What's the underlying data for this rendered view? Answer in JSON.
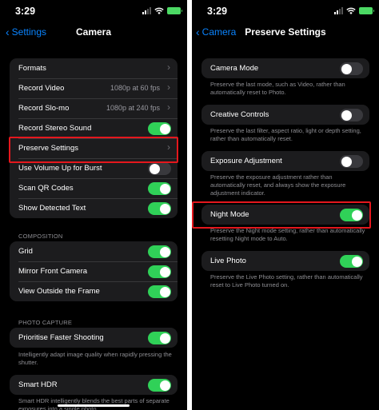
{
  "left": {
    "status": {
      "time": "3:29"
    },
    "nav": {
      "back_label": "Settings",
      "title": "Camera"
    },
    "group1": {
      "formats": "Formats",
      "record_video": {
        "label": "Record Video",
        "value": "1080p at 60 fps"
      },
      "record_slomo": {
        "label": "Record Slo-mo",
        "value": "1080p at 240 fps"
      },
      "stereo": {
        "label": "Record Stereo Sound",
        "on": true
      },
      "preserve": "Preserve Settings",
      "volume": {
        "label": "Use Volume Up for Burst",
        "on": false
      },
      "qr": {
        "label": "Scan QR Codes",
        "on": true
      },
      "detected_text": {
        "label": "Show Detected Text",
        "on": true
      }
    },
    "composition": {
      "header": "COMPOSITION",
      "grid": {
        "label": "Grid",
        "on": true
      },
      "mirror": {
        "label": "Mirror Front Camera",
        "on": true
      },
      "outside": {
        "label": "View Outside the Frame",
        "on": true
      }
    },
    "photo_capture": {
      "header": "PHOTO CAPTURE",
      "faster": {
        "label": "Prioritise Faster Shooting",
        "on": true
      },
      "faster_footer": "Intelligently adapt image quality when rapidly pressing the shutter."
    },
    "hdr": {
      "label": "Smart HDR",
      "on": true,
      "footer": "Smart HDR intelligently blends the best parts of separate exposures into a single photo."
    }
  },
  "right": {
    "status": {
      "time": "3:29"
    },
    "nav": {
      "back_label": "Camera",
      "title": "Preserve Settings"
    },
    "camera_mode": {
      "label": "Camera Mode",
      "on": false,
      "footer": "Preserve the last mode, such as Video, rather than automatically reset to Photo."
    },
    "creative": {
      "label": "Creative Controls",
      "on": false,
      "footer": "Preserve the last filter, aspect ratio, light or depth setting, rather than automatically reset."
    },
    "exposure": {
      "label": "Exposure Adjustment",
      "on": false,
      "footer": "Preserve the exposure adjustment rather than automatically reset, and always show the exposure adjustment indicator."
    },
    "night": {
      "label": "Night Mode",
      "on": true,
      "footer": "Preserve the Night mode setting, rather than automatically resetting Night mode to Auto."
    },
    "live": {
      "label": "Live Photo",
      "on": true,
      "footer": "Preserve the Live Photo setting, rather than automatically reset to Live Photo turned on."
    }
  },
  "colors": {
    "accent": "#0a84ff",
    "toggle_on": "#30d158",
    "highlight": "#e5171d",
    "cell_bg": "#1c1c1e"
  }
}
